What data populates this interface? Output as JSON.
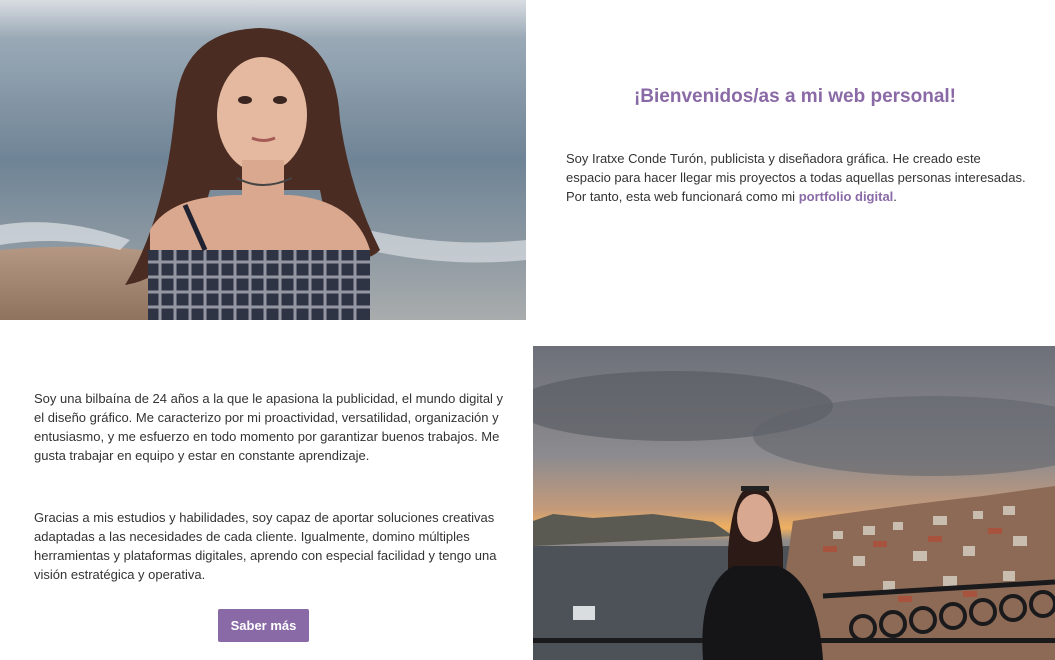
{
  "welcome": {
    "title": "¡Bienvenidos/as a mi web personal!",
    "intro_text": "Soy Iratxe Conde Turón, publicista y diseñadora gráfica. He creado este espacio para hacer llegar mis proyectos a todas aquellas personas interesadas. Por tanto, esta web funcionará como mi ",
    "intro_highlight": "portfolio digital",
    "intro_end": "."
  },
  "about": {
    "paragraph1": "Soy una bilbaína de 24 años a la que le apasiona la publicidad, el mundo digital y el diseño gráfico. Me caracterizo por mi proactividad, versatilidad, organización y entusiasmo, y me esfuerzo en todo momento por garantizar buenos trabajos. Me gusta trabajar en equipo y estar en constante aprendizaje.",
    "paragraph2": "Gracias a mis estudios y habilidades, soy capaz de aportar soluciones creativas adaptadas a las necesidades de cada cliente. Igualmente, domino múltiples herramientas y plataformas digitales, aprendo con especial facilidad y tengo una visión estratégica y operativa.",
    "button_label": "Saber más"
  },
  "colors": {
    "accent": "#8a6aa6",
    "text": "#333333",
    "background": "#ffffff"
  }
}
